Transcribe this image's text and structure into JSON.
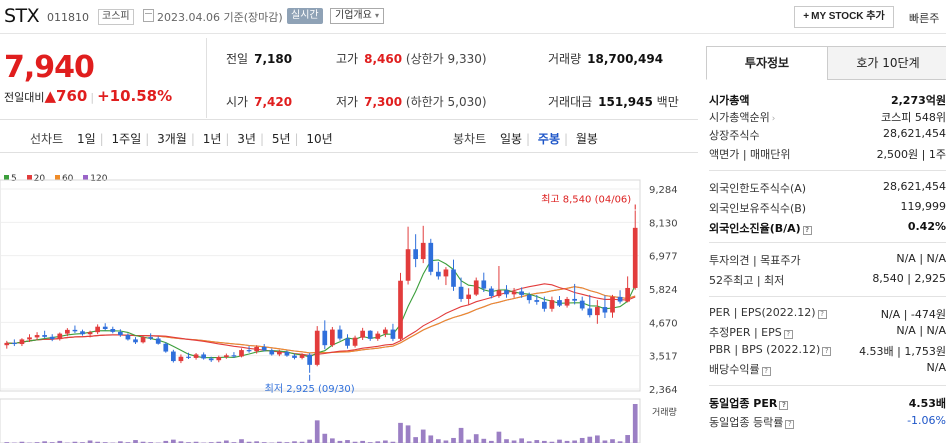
{
  "header": {
    "stock_name": "STX",
    "stock_code": "011810",
    "market": "코스피",
    "date": "2023.04.06  기준(장마감)",
    "realtime_badge": "실시간",
    "company_info_label": "기업개요",
    "company_info_arrow": "▾",
    "my_stock_label": "MY STOCK 추가",
    "my_stock_plus": "+",
    "quick_link": "빠른주"
  },
  "price": {
    "current": "7,940",
    "change_label": "전일대비",
    "change_arrow": "▲",
    "change_value": "760",
    "change_percent": "+10.58%"
  },
  "metrics": {
    "prev_close_label": "전일",
    "prev_close": "7,180",
    "high_label": "고가",
    "high": "8,460",
    "upper_limit": "(상한가 9,330)",
    "volume_label": "거래량",
    "volume": "18,700,494",
    "open_label": "시가",
    "open": "7,420",
    "low_label": "저가",
    "low": "7,300",
    "lower_limit": "(하한가 5,030)",
    "amount_label": "거래대금",
    "amount": "151,945",
    "amount_unit": "백만"
  },
  "toolbar": {
    "line_chart_label": "선차트",
    "periods": [
      "1일",
      "1주일",
      "3개월",
      "1년",
      "3년",
      "5년",
      "10년"
    ],
    "candle_chart_label": "봉차트",
    "candles": [
      "일봉",
      "주봉",
      "월봉"
    ],
    "active_candle": "주봉"
  },
  "legend": [
    {
      "label": "5",
      "color": "#3c9f3c"
    },
    {
      "label": "20",
      "color": "#e23c3c"
    },
    {
      "label": "60",
      "color": "#f08c28"
    },
    {
      "label": "120",
      "color": "#9a64c8"
    }
  ],
  "chart_data": {
    "type": "candlestick",
    "y_ticks": [
      "9,284",
      "8,130",
      "6,977",
      "5,824",
      "4,670",
      "3,517",
      "2,364"
    ],
    "ylim": [
      2364,
      9284
    ],
    "annotation_high": "최고 8,540 (04/06)",
    "annotation_low": "최저 2,925 (09/30)",
    "volume_label": "거래량",
    "up_color": "#e23c3c",
    "down_color": "#2f6fdb",
    "candles": [
      [
        3880,
        4030,
        3760,
        3960
      ],
      [
        3960,
        4080,
        3850,
        3920
      ],
      [
        3920,
        4120,
        3850,
        4080
      ],
      [
        4080,
        4260,
        3990,
        4150
      ],
      [
        4150,
        4330,
        4060,
        4230
      ],
      [
        4230,
        4380,
        4120,
        4170
      ],
      [
        4170,
        4260,
        4020,
        4090
      ],
      [
        4090,
        4320,
        4040,
        4280
      ],
      [
        4280,
        4470,
        4190,
        4410
      ],
      [
        4410,
        4560,
        4300,
        4360
      ],
      [
        4360,
        4420,
        4210,
        4260
      ],
      [
        4260,
        4380,
        4150,
        4330
      ],
      [
        4330,
        4600,
        4260,
        4520
      ],
      [
        4520,
        4640,
        4390,
        4440
      ],
      [
        4440,
        4520,
        4290,
        4340
      ],
      [
        4340,
        4430,
        4170,
        4230
      ],
      [
        4230,
        4290,
        4040,
        4080
      ],
      [
        4080,
        4160,
        3920,
        3980
      ],
      [
        3980,
        4220,
        3940,
        4160
      ],
      [
        4160,
        4290,
        4060,
        4110
      ],
      [
        4110,
        4180,
        3900,
        3930
      ],
      [
        3930,
        3980,
        3620,
        3660
      ],
      [
        3660,
        3720,
        3280,
        3330
      ],
      [
        3330,
        3560,
        3260,
        3480
      ],
      [
        3480,
        3620,
        3400,
        3440
      ],
      [
        3440,
        3610,
        3380,
        3560
      ],
      [
        3560,
        3630,
        3380,
        3420
      ],
      [
        3420,
        3480,
        3300,
        3360
      ],
      [
        3360,
        3520,
        3290,
        3470
      ],
      [
        3470,
        3590,
        3410,
        3530
      ],
      [
        3530,
        3640,
        3440,
        3490
      ],
      [
        3490,
        3770,
        3460,
        3710
      ],
      [
        3710,
        3850,
        3620,
        3670
      ],
      [
        3670,
        3880,
        3590,
        3820
      ],
      [
        3820,
        3920,
        3660,
        3700
      ],
      [
        3700,
        3760,
        3520,
        3560
      ],
      [
        3560,
        3720,
        3500,
        3650
      ],
      [
        3650,
        3700,
        3480,
        3520
      ],
      [
        3520,
        3590,
        3390,
        3440
      ],
      [
        3440,
        3600,
        3390,
        3550
      ],
      [
        3550,
        3610,
        2925,
        3200
      ],
      [
        3200,
        4540,
        3150,
        4380
      ],
      [
        4380,
        4740,
        3740,
        3880
      ],
      [
        3880,
        4510,
        3820,
        4420
      ],
      [
        4420,
        4560,
        4040,
        4110
      ],
      [
        4110,
        4260,
        3760,
        3860
      ],
      [
        3860,
        4210,
        3800,
        4140
      ],
      [
        4140,
        4480,
        4060,
        4380
      ],
      [
        4380,
        4400,
        4030,
        4100
      ],
      [
        4100,
        4360,
        4030,
        4280
      ],
      [
        4280,
        4500,
        4160,
        4420
      ],
      [
        4420,
        4620,
        4020,
        4100
      ],
      [
        4100,
        6380,
        4040,
        6110
      ],
      [
        6110,
        7980,
        5980,
        7200
      ],
      [
        7200,
        7720,
        6580,
        6860
      ],
      [
        6860,
        8010,
        6720,
        7420
      ],
      [
        7420,
        7560,
        6300,
        6420
      ],
      [
        6420,
        6760,
        6150,
        6260
      ],
      [
        6260,
        6580,
        5960,
        6500
      ],
      [
        6500,
        6840,
        5760,
        5900
      ],
      [
        5900,
        6220,
        5380,
        5480
      ],
      [
        5480,
        5850,
        5280,
        5630
      ],
      [
        5630,
        6220,
        5580,
        6120
      ],
      [
        6120,
        6390,
        5720,
        5840
      ],
      [
        5840,
        5920,
        5500,
        5580
      ],
      [
        5580,
        6620,
        5520,
        5780
      ],
      [
        5780,
        5960,
        5520,
        5640
      ],
      [
        5640,
        5860,
        5520,
        5740
      ],
      [
        5740,
        5880,
        5520,
        5620
      ],
      [
        5620,
        5700,
        5320,
        5440
      ],
      [
        5440,
        5620,
        5280,
        5380
      ],
      [
        5380,
        5560,
        5040,
        5140
      ],
      [
        5140,
        5560,
        5040,
        5440
      ],
      [
        5440,
        5580,
        5200,
        5250
      ],
      [
        5250,
        5550,
        5180,
        5480
      ],
      [
        5480,
        6000,
        5290,
        5420
      ],
      [
        5420,
        5560,
        5080,
        5150
      ],
      [
        5150,
        5620,
        4840,
        4920
      ],
      [
        4920,
        5440,
        4620,
        5200
      ],
      [
        5200,
        5600,
        4820,
        5010
      ],
      [
        5010,
        5620,
        4830,
        5550
      ],
      [
        5550,
        5780,
        5320,
        5390
      ],
      [
        5390,
        6260,
        5360,
        5860
      ],
      [
        5860,
        8540,
        5800,
        7940
      ]
    ],
    "volumes": [
      0.02,
      0.01,
      0.03,
      0.01,
      0.02,
      0.04,
      0.02,
      0.05,
      0.01,
      0.03,
      0.02,
      0.06,
      0.03,
      0.02,
      0.01,
      0.04,
      0.02,
      0.07,
      0.03,
      0.02,
      0.01,
      0.05,
      0.08,
      0.04,
      0.02,
      0.03,
      0.01,
      0.02,
      0.03,
      0.06,
      0.02,
      0.09,
      0.03,
      0.04,
      0.02,
      0.01,
      0.03,
      0.02,
      0.04,
      0.03,
      0.08,
      0.54,
      0.22,
      0.11,
      0.05,
      0.07,
      0.03,
      0.05,
      0.02,
      0.04,
      0.06,
      0.03,
      0.48,
      0.42,
      0.14,
      0.32,
      0.18,
      0.09,
      0.06,
      0.12,
      0.36,
      0.08,
      0.21,
      0.1,
      0.05,
      0.27,
      0.09,
      0.06,
      0.11,
      0.04,
      0.07,
      0.05,
      0.03,
      0.08,
      0.05,
      0.06,
      0.12,
      0.15,
      0.18,
      0.06,
      0.09,
      0.04,
      0.19,
      0.93
    ]
  },
  "right_panel": {
    "tab_info": "투자정보",
    "tab_quote": "호가 10단계",
    "market_cap_label": "시가총액",
    "market_cap": "2,273억원",
    "market_cap_rank_label": "시가총액순위",
    "market_cap_rank": "코스피 548위",
    "shares_label": "상장주식수",
    "shares": "28,621,454",
    "par_label": "액면가 | 매매단위",
    "par": "2,500원  |  1주",
    "foreign_limit_label": "외국인한도주식수(A)",
    "foreign_limit": "28,621,454",
    "foreign_hold_label": "외국인보유주식수(B)",
    "foreign_hold": "119,999",
    "foreign_ratio_label": "외국인소진율(B/A)",
    "foreign_ratio": "0.42%",
    "opinion_label": "투자의견 | 목표주가",
    "opinion": "N/A  |  N/A",
    "week52_label": "52주최고 | 최저",
    "week52": "8,540  |  2,925",
    "per_label": "PER | EPS(2022.12)",
    "per": "N/A  |  -474원",
    "est_per_label": "추정PER | EPS",
    "est_per": "N/A  |  N/A",
    "pbr_label": "PBR | BPS (2022.12)",
    "pbr": "4.53배  |  1,753원",
    "dividend_label": "배당수익률",
    "dividend": "N/A",
    "sector_per_label": "동일업종 PER",
    "sector_per": "4.53배",
    "sector_change_label": "동일업종 등락률",
    "sector_change": "-1.06%",
    "info_icon": "?"
  }
}
